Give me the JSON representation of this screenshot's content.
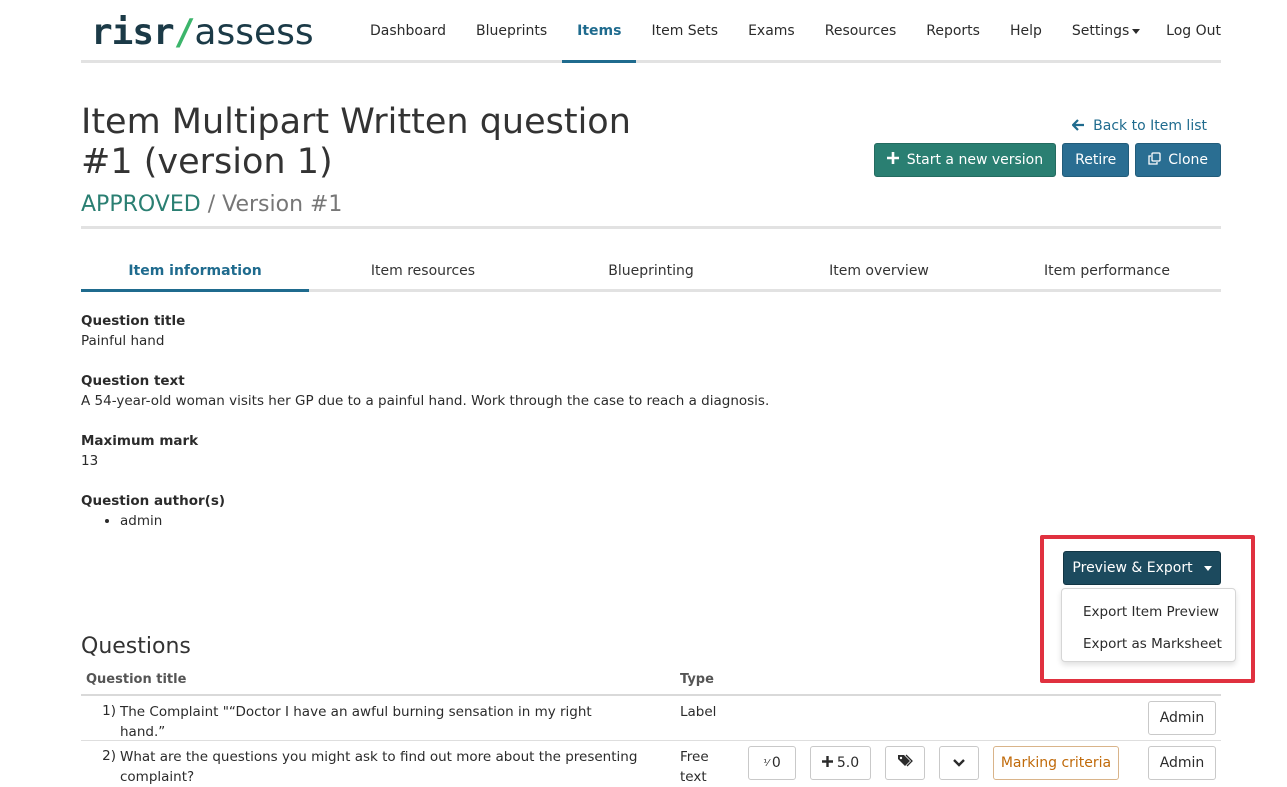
{
  "header": {
    "logo": {
      "risr": "risr",
      "slash": "/",
      "assess": "assess"
    },
    "nav": [
      "Dashboard",
      "Blueprints",
      "Items",
      "Item Sets",
      "Exams",
      "Resources",
      "Reports",
      "Help",
      "Settings"
    ],
    "active_nav": "Items",
    "logout": "Log Out"
  },
  "page": {
    "title": "Item Multipart Written question #1 (version 1)",
    "status": "APPROVED",
    "status_separator": " / ",
    "version": "Version #1",
    "back_link": "Back to Item list",
    "actions": {
      "new_version": "Start a new version",
      "retire": "Retire",
      "clone": "Clone"
    }
  },
  "tabs": [
    "Item information",
    "Item resources",
    "Blueprinting",
    "Item overview",
    "Item performance"
  ],
  "active_tab": "Item information",
  "info": {
    "question_title_label": "Question title",
    "question_title": "Painful hand",
    "question_text_label": "Question text",
    "question_text": "A 54-year-old woman visits her GP due to a painful hand. Work through the case to reach a diagnosis.",
    "max_mark_label": "Maximum mark",
    "max_mark": "13",
    "authors_label": "Question author(s)",
    "authors": [
      "admin"
    ]
  },
  "preview_export": {
    "button_label": "Preview & Export",
    "menu": [
      "Export Item Preview",
      "Export as Marksheet"
    ]
  },
  "questions": {
    "heading": "Questions",
    "columns": {
      "title": "Question title",
      "type": "Type"
    },
    "rows": [
      {
        "num": "1)",
        "title": "The Complaint \"“Doctor I have an awful burning sensation in my right hand.”",
        "type": "Label",
        "admin": "Admin"
      },
      {
        "num": "2)",
        "title": "What are the questions you might ask to find out more about the presenting complaint?",
        "type": "Free text",
        "count": "0",
        "score": "5.0",
        "criteria": "Marking criteria",
        "admin": "Admin"
      }
    ]
  },
  "colors": {
    "accent": "#1f6b8e",
    "green": "#2a7f72",
    "highlight": "#e0313f",
    "dark_button": "#1c4a5e"
  }
}
